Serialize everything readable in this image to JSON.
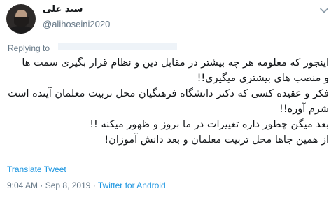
{
  "author": {
    "display_name": "سید علی",
    "handle": "@alihoseini2020"
  },
  "reply": {
    "prefix": "Replying to"
  },
  "tweet": {
    "lines": [
      "اینجور که معلومه هر چه بیشتر در مقابل دین و نظام قرار بگیری سمت ها",
      "و منصب های بیشتری میگیری!!",
      "فکر و عقیده کسی که دکتر دانشگاه فرهنگیان محل تربیت معلمان آینده است",
      "شرم آوره!!",
      "بعد میگن چطور داره تغییرات در ما بروز و ظهور میکنه !!",
      "از همین جاها محل تربیت معلمان و بعد دانش آموزان!"
    ]
  },
  "actions": {
    "translate": "Translate Tweet"
  },
  "meta": {
    "time": "9:04 AM",
    "date": "Sep 8, 2019",
    "separator": "·",
    "source": "Twitter for Android"
  },
  "icons": {
    "menu": "chevron-down-icon"
  },
  "colors": {
    "link": "#1b95e0",
    "secondary_text": "#657786"
  }
}
